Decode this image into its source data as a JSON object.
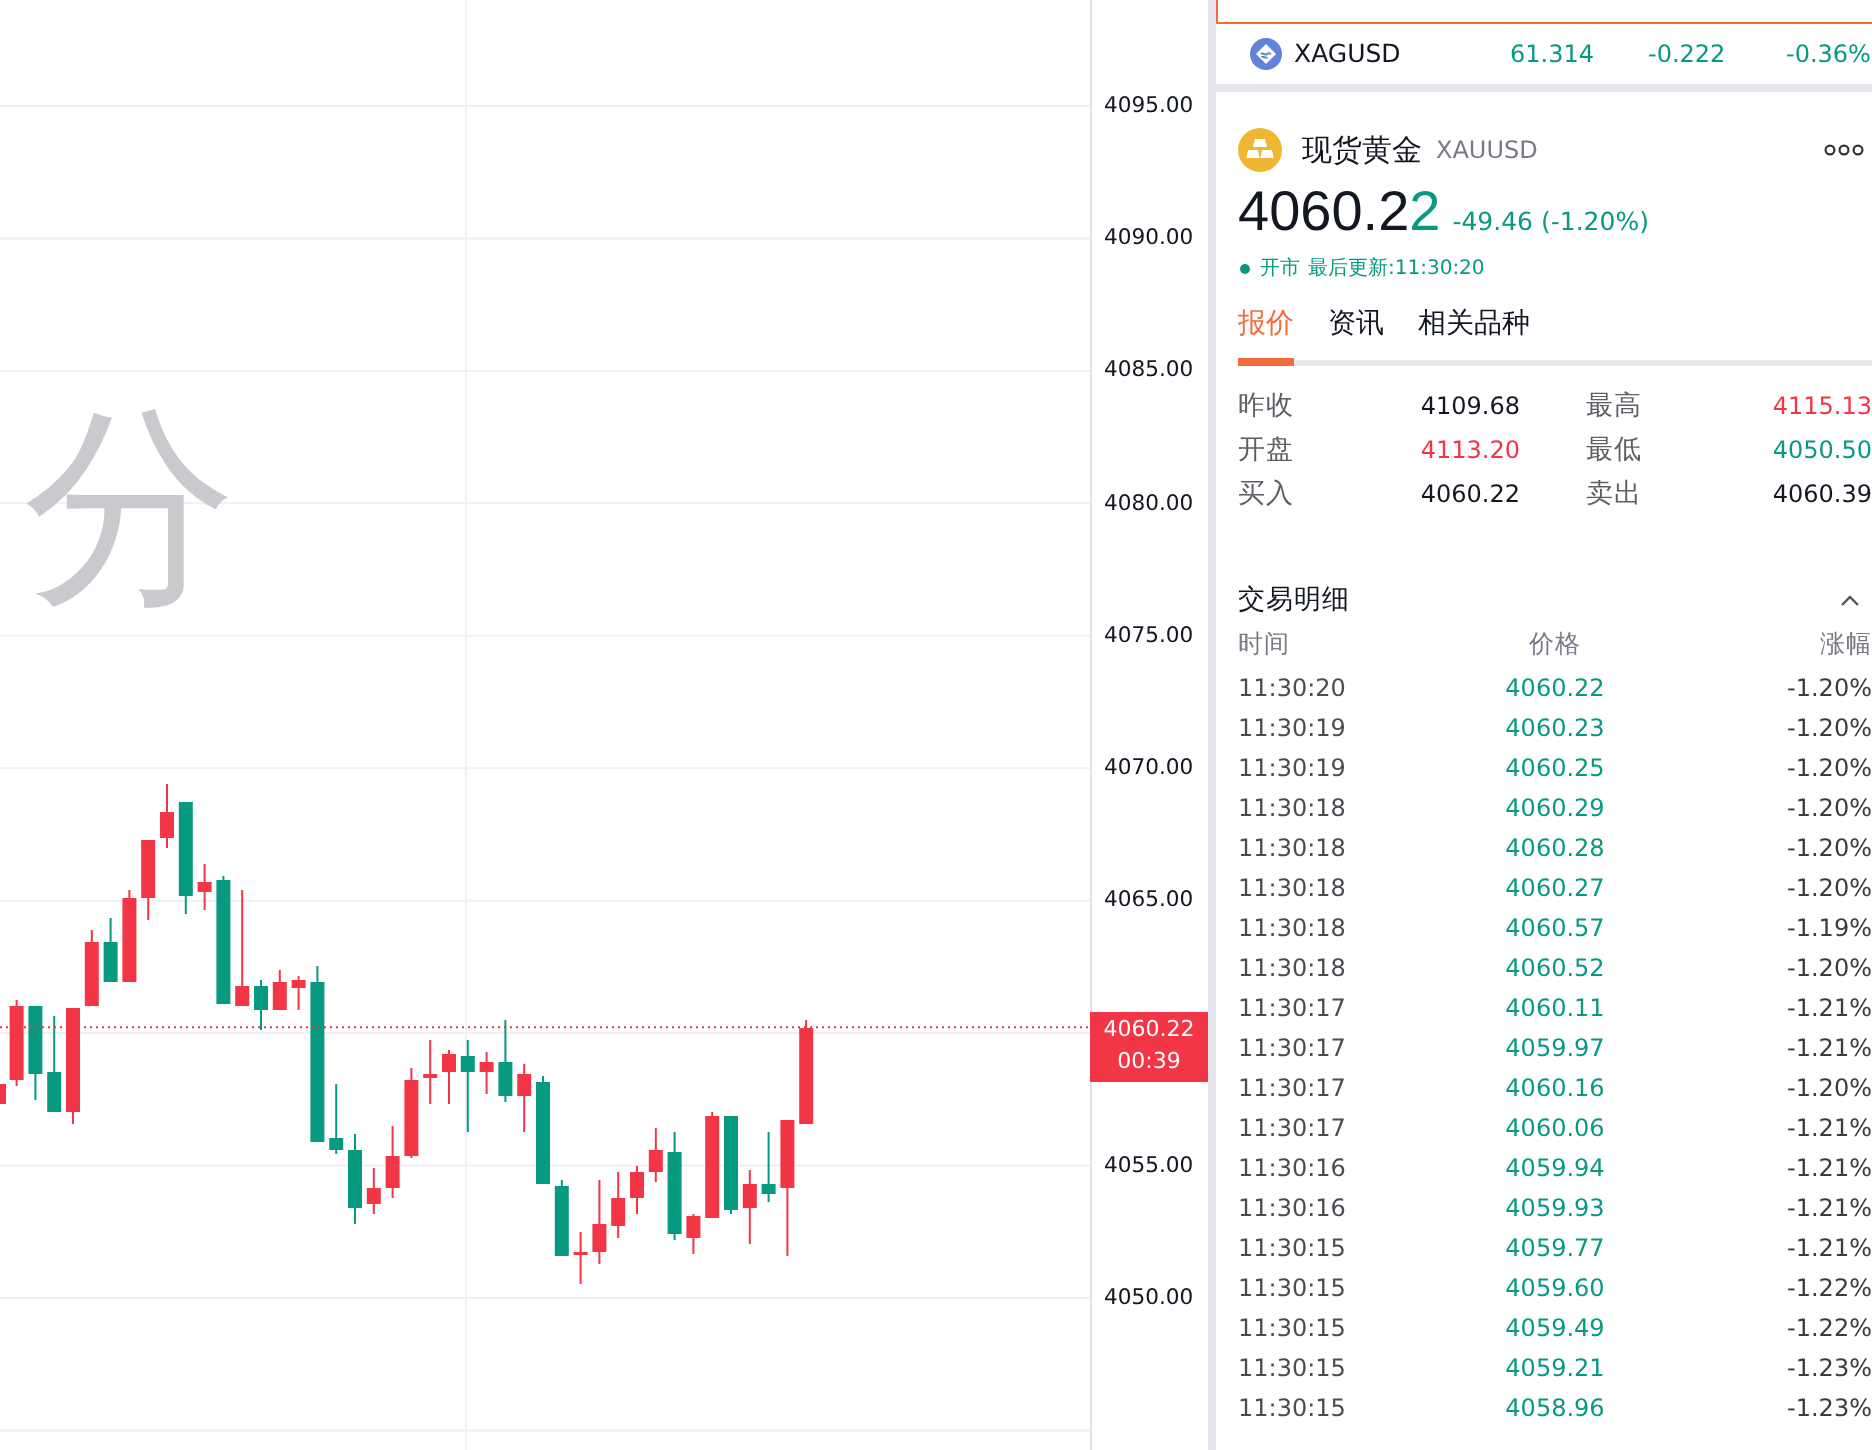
{
  "chart": {
    "watermark": "分",
    "price_axis": {
      "ticks": [
        "4095.00",
        "4090.00",
        "4085.00",
        "4080.00",
        "4075.00",
        "4070.00",
        "4065.00",
        "4055.00",
        "4050.00"
      ],
      "price_tag": {
        "price": "4060.22",
        "countdown": "00:39"
      }
    }
  },
  "watchlist": [
    {
      "selected": true
    },
    {
      "symbol": "XAGUSD",
      "last": "61.314",
      "change": "-0.222",
      "change_pct": "-0.36%",
      "down": true,
      "selected": false
    }
  ],
  "quote": {
    "name": "现货黄金",
    "code": "XAUUSD",
    "price": {
      "main": "4060.2",
      "changed": "2",
      "changed_down": true
    },
    "change": "-49.46 (-1.20%)",
    "down": true,
    "market": {
      "status": "开市",
      "open": true
    },
    "last_update": "最后更新:11:30:20"
  },
  "tabs": [
    {
      "label": "报价",
      "selected": true
    },
    {
      "label": "资讯",
      "selected": false
    },
    {
      "label": "相关品种",
      "selected": false
    }
  ],
  "stats": [
    {
      "label": "昨收",
      "value": "4109.68",
      "color": "#131722"
    },
    {
      "label": "最高",
      "value": "4115.13",
      "color": "#f23645"
    },
    {
      "label": "开盘",
      "value": "4113.20",
      "color": "#f23645"
    },
    {
      "label": "最低",
      "value": "4050.50",
      "color": "#089981"
    },
    {
      "label": "买入",
      "value": "4060.22",
      "color": "#131722"
    },
    {
      "label": "卖出",
      "value": "4060.39",
      "color": "#131722"
    }
  ],
  "trades": {
    "title": "交易明细",
    "expanded": true,
    "columns": [
      "时间",
      "价格",
      "涨幅"
    ],
    "rows": [
      {
        "time": "11:30:20",
        "price": "4060.22",
        "change_pct": "-1.20%",
        "down": true
      },
      {
        "time": "11:30:19",
        "price": "4060.23",
        "change_pct": "-1.20%",
        "down": true
      },
      {
        "time": "11:30:19",
        "price": "4060.25",
        "change_pct": "-1.20%",
        "down": true
      },
      {
        "time": "11:30:18",
        "price": "4060.29",
        "change_pct": "-1.20%",
        "down": true
      },
      {
        "time": "11:30:18",
        "price": "4060.28",
        "change_pct": "-1.20%",
        "down": true
      },
      {
        "time": "11:30:18",
        "price": "4060.27",
        "change_pct": "-1.20%",
        "down": true
      },
      {
        "time": "11:30:18",
        "price": "4060.57",
        "change_pct": "-1.19%",
        "down": true
      },
      {
        "time": "11:30:18",
        "price": "4060.52",
        "change_pct": "-1.20%",
        "down": true
      },
      {
        "time": "11:30:17",
        "price": "4060.11",
        "change_pct": "-1.21%",
        "down": true
      },
      {
        "time": "11:30:17",
        "price": "4059.97",
        "change_pct": "-1.21%",
        "down": true
      },
      {
        "time": "11:30:17",
        "price": "4060.16",
        "change_pct": "-1.20%",
        "down": true
      },
      {
        "time": "11:30:17",
        "price": "4060.06",
        "change_pct": "-1.21%",
        "down": true
      },
      {
        "time": "11:30:16",
        "price": "4059.94",
        "change_pct": "-1.21%",
        "down": true
      },
      {
        "time": "11:30:16",
        "price": "4059.93",
        "change_pct": "-1.21%",
        "down": true
      },
      {
        "time": "11:30:15",
        "price": "4059.77",
        "change_pct": "-1.21%",
        "down": true
      },
      {
        "time": "11:30:15",
        "price": "4059.60",
        "change_pct": "-1.22%",
        "down": true
      },
      {
        "time": "11:30:15",
        "price": "4059.49",
        "change_pct": "-1.22%",
        "down": true
      },
      {
        "time": "11:30:15",
        "price": "4059.21",
        "change_pct": "-1.23%",
        "down": true
      },
      {
        "time": "11:30:15",
        "price": "4058.96",
        "change_pct": "-1.23%",
        "down": true
      }
    ]
  }
}
